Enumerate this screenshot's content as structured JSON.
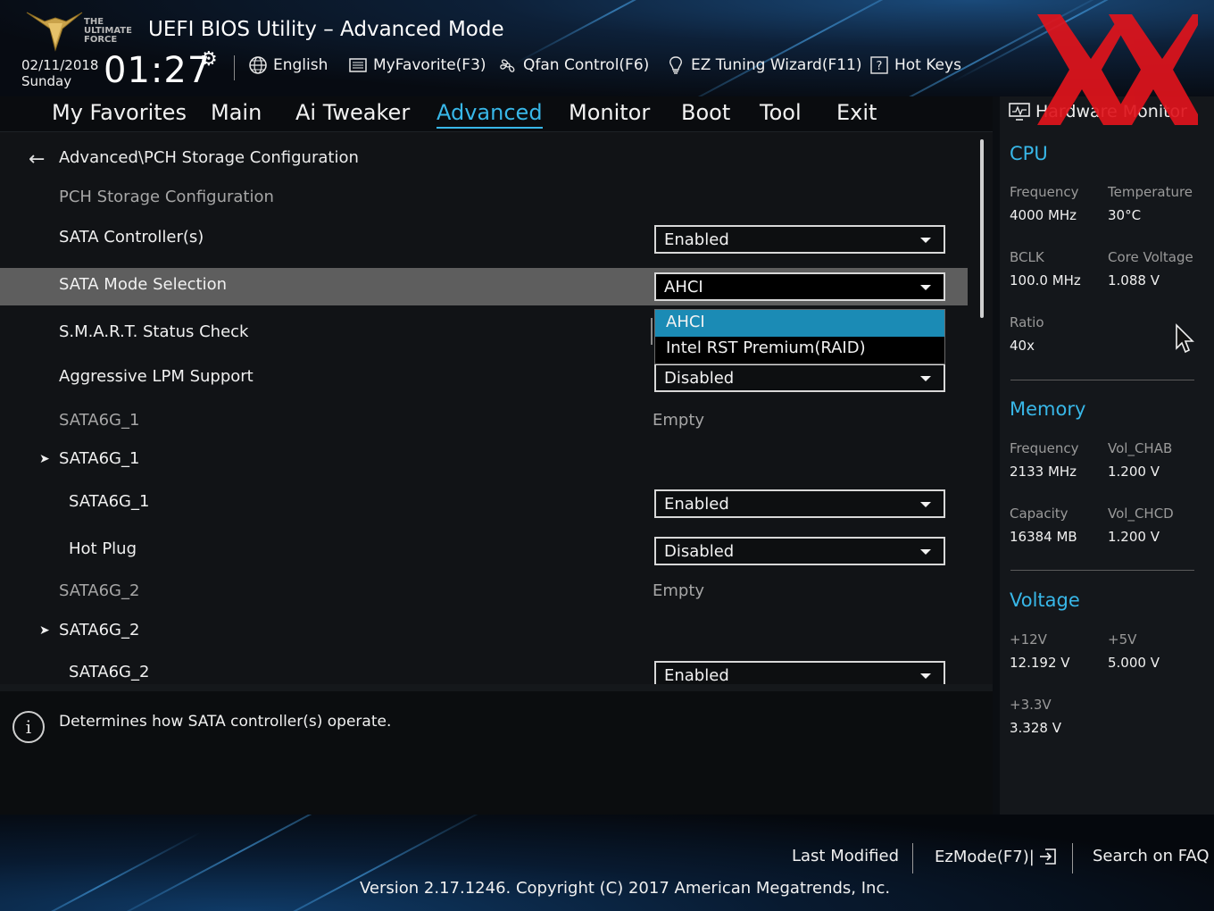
{
  "header": {
    "logo_text": [
      "THE",
      "ULTIMATE",
      "FORCE"
    ],
    "title": "UEFI BIOS Utility – Advanced Mode",
    "date": "02/11/2018",
    "day": "Sunday",
    "time": "01:27",
    "tools": [
      {
        "label": "English",
        "icon": "globe-icon"
      },
      {
        "label": "MyFavorite(F3)",
        "icon": "favorite-list-icon"
      },
      {
        "label": "Qfan Control(F6)",
        "icon": "fan-icon"
      },
      {
        "label": "EZ Tuning Wizard(F11)",
        "icon": "lightbulb-icon"
      },
      {
        "label": "Hot Keys",
        "icon": "question-box-icon"
      }
    ]
  },
  "nav": {
    "tabs": [
      "My Favorites",
      "Main",
      "Ai Tweaker",
      "Advanced",
      "Monitor",
      "Boot",
      "Tool",
      "Exit"
    ],
    "active": "Advanced"
  },
  "main": {
    "breadcrumb": "Advanced\\PCH Storage Configuration",
    "rows": {
      "section_title": "PCH Storage Configuration",
      "sata_controllers": {
        "label": "SATA Controller(s)",
        "value": "Enabled"
      },
      "sata_mode": {
        "label": "SATA Mode Selection",
        "value": "AHCI"
      },
      "smart": {
        "label": "S.M.A.R.T. Status Check"
      },
      "lpm": {
        "label": "Aggressive LPM Support",
        "value": "Disabled"
      },
      "sata1_status": {
        "label": "SATA6G_1",
        "value": "Empty"
      },
      "sata1_group": {
        "label": "SATA6G_1"
      },
      "sata1_enable": {
        "label": "SATA6G_1",
        "value": "Enabled"
      },
      "sata1_hotplug": {
        "label": "Hot Plug",
        "value": "Disabled"
      },
      "sata2_status": {
        "label": "SATA6G_2",
        "value": "Empty"
      },
      "sata2_group": {
        "label": "SATA6G_2"
      },
      "sata2_enable": {
        "label": "SATA6G_2",
        "value": "Enabled"
      }
    },
    "dropdown_options": [
      "AHCI",
      "Intel RST Premium(RAID)"
    ],
    "dropdown_selected": "AHCI"
  },
  "help": {
    "text": "Determines how SATA controller(s) operate."
  },
  "hardware_monitor": {
    "title": "Hardware Monitor",
    "cpu": {
      "heading": "CPU",
      "frequency_label": "Frequency",
      "frequency": "4000 MHz",
      "temperature_label": "Temperature",
      "temperature": "30°C",
      "bclk_label": "BCLK",
      "bclk": "100.0 MHz",
      "core_voltage_label": "Core Voltage",
      "core_voltage": "1.088 V",
      "ratio_label": "Ratio",
      "ratio": "40x"
    },
    "memory": {
      "heading": "Memory",
      "frequency_label": "Frequency",
      "frequency": "2133 MHz",
      "vol_chab_label": "Vol_CHAB",
      "vol_chab": "1.200 V",
      "capacity_label": "Capacity",
      "capacity": "16384 MB",
      "vol_chcd_label": "Vol_CHCD",
      "vol_chcd": "1.200 V"
    },
    "voltage": {
      "heading": "Voltage",
      "v12_label": "+12V",
      "v12": "12.192 V",
      "v5_label": "+5V",
      "v5": "5.000 V",
      "v33_label": "+3.3V",
      "v33": "3.328 V"
    }
  },
  "footer": {
    "last_modified": "Last Modified",
    "ezmode": "EzMode(F7)|",
    "search_faq": "Search on FAQ",
    "version": "Version 2.17.1246. Copyright (C) 2017 American Megatrends, Inc."
  },
  "colors": {
    "accent": "#38b7e8",
    "selection": "#1b8bb5",
    "highlight_row": "#5e5e5e",
    "watermark": "#e0141c"
  }
}
